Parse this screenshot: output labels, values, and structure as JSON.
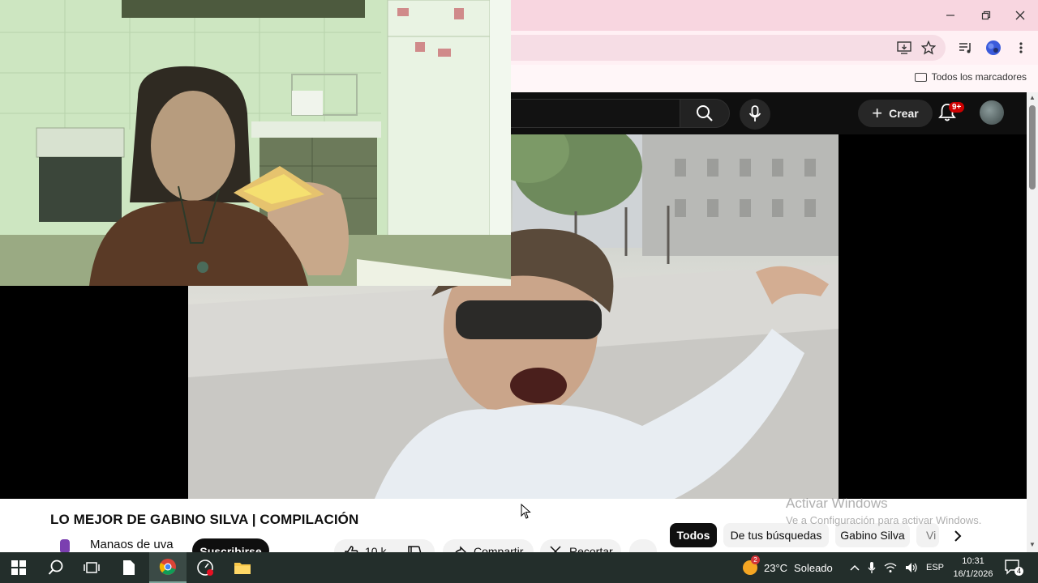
{
  "browser": {
    "bookmarks_bar": {
      "all_bookmarks_label": "Todos los marcadores"
    }
  },
  "youtube": {
    "header": {
      "create_label": "Crear",
      "notification_badge": "9+"
    },
    "video": {
      "title": "LO MEJOR DE GABINO SILVA | COMPILACIÓN",
      "channel_name": "Manaos de uva",
      "subscribe_label": "Suscribirse",
      "like_count": "10 k",
      "share_label": "Compartir",
      "clip_label": "Recortar"
    },
    "chips": [
      {
        "label": "Todos",
        "active": true
      },
      {
        "label": "De tus búsquedas",
        "active": false
      },
      {
        "label": "Gabino Silva",
        "active": false
      },
      {
        "label": "Vi",
        "active": false
      }
    ]
  },
  "watermark": {
    "title": "Activar Windows",
    "subtitle": "Ve a Configuración para activar Windows."
  },
  "taskbar": {
    "weather": {
      "temp": "23°C",
      "condition": "Soleado",
      "badge": "2"
    },
    "language": "ESP",
    "time": "10:31",
    "date": "16/1/2026",
    "notification_count": "4"
  },
  "icons": [
    "minimize-icon",
    "maximize-icon",
    "close-icon",
    "install-icon",
    "star-icon",
    "media-icon",
    "profile-icon",
    "menu-icon",
    "folder-icon",
    "search-icon",
    "mic-icon",
    "bell-icon",
    "like-icon",
    "share-icon",
    "scissors-icon",
    "chevron-right-icon",
    "windows-icon"
  ]
}
